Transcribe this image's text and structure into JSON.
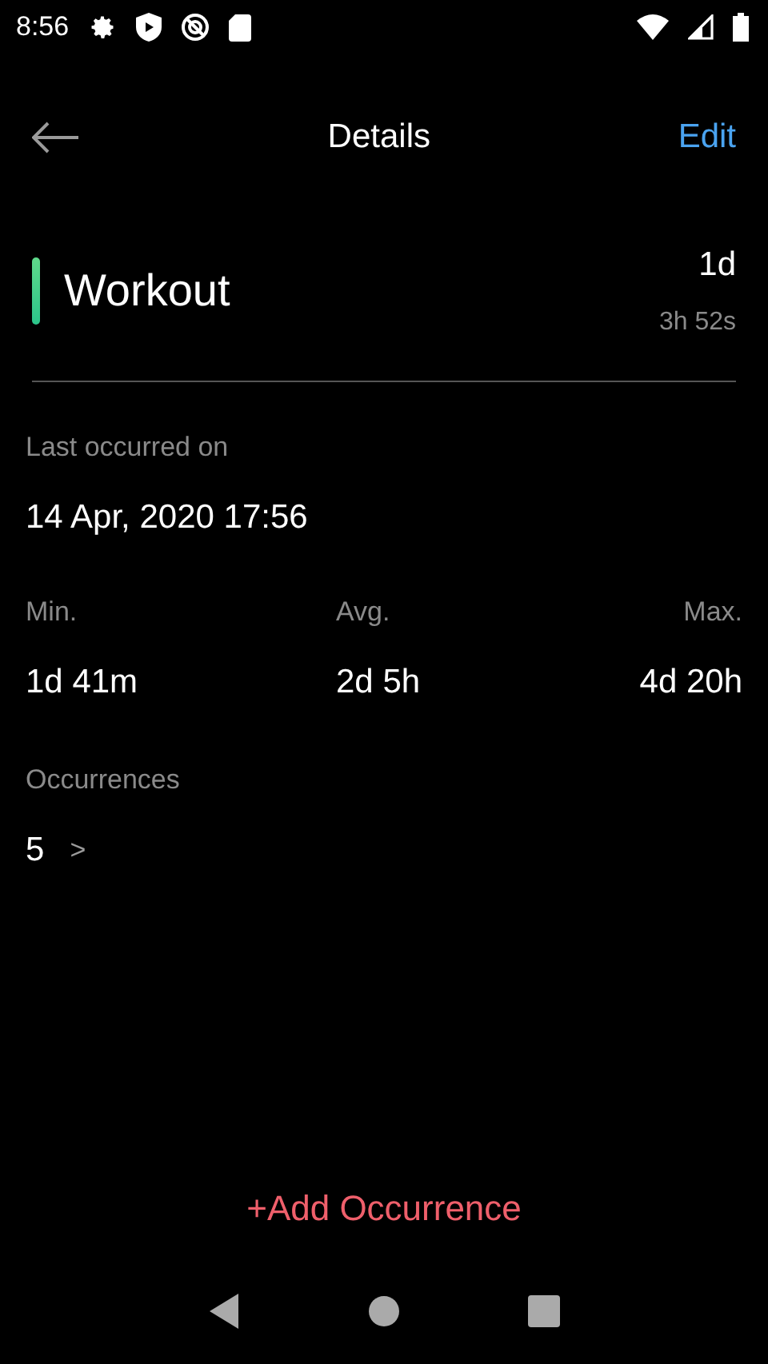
{
  "status_bar": {
    "time": "8:56"
  },
  "header": {
    "title": "Details",
    "action": "Edit"
  },
  "event": {
    "name": "Workout",
    "elapsed_main": "1d",
    "elapsed_detail": "3h 52s"
  },
  "last_occurred": {
    "label": "Last occurred on",
    "value": "14 Apr, 2020 17:56"
  },
  "stats": [
    {
      "label": "Min.",
      "value": "1d 41m"
    },
    {
      "label": "Avg.",
      "value": "2d 5h"
    },
    {
      "label": "Max.",
      "value": "4d 20h"
    }
  ],
  "occurrences": {
    "label": "Occurrences",
    "count": "5",
    "chevron": ">"
  },
  "add_button": "+Add Occurrence"
}
